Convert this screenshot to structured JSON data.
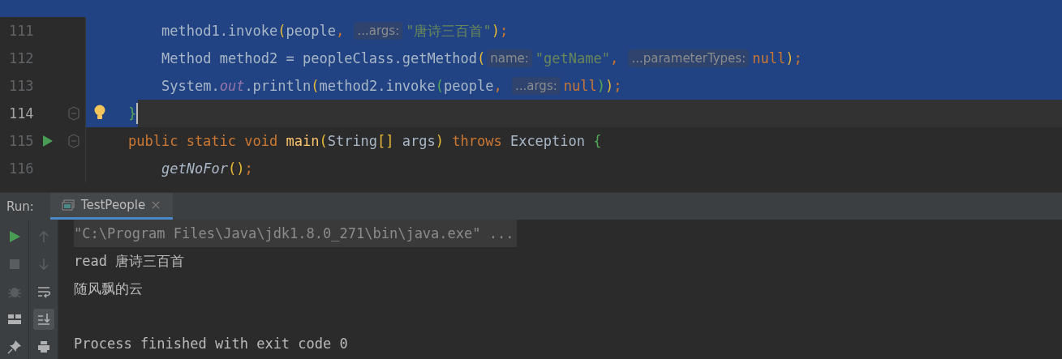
{
  "editor": {
    "lines": [
      {
        "number": "111",
        "selected": true,
        "current": false,
        "run": false,
        "fold": false,
        "bulb": false,
        "tokens": [
          {
            "kind": "text",
            "text": "        method1.invoke"
          },
          {
            "kind": "bracket1",
            "text": "("
          },
          {
            "kind": "text",
            "text": "people"
          },
          {
            "kind": "punct",
            "text": ", "
          },
          {
            "kind": "hint",
            "text": "...args:"
          },
          {
            "kind": "string",
            "text": "\"唐诗三百首\""
          },
          {
            "kind": "bracket1",
            "text": ")"
          },
          {
            "kind": "punct",
            "text": ";"
          }
        ]
      },
      {
        "number": "112",
        "selected": true,
        "current": false,
        "run": false,
        "fold": false,
        "bulb": false,
        "tokens": [
          {
            "kind": "text",
            "text": "        Method method2 = peopleClass.getMethod"
          },
          {
            "kind": "bracket1",
            "text": "("
          },
          {
            "kind": "hint",
            "text": "name:"
          },
          {
            "kind": "string",
            "text": "\"getName\""
          },
          {
            "kind": "punct",
            "text": ", "
          },
          {
            "kind": "hint",
            "text": "...parameterTypes:"
          },
          {
            "kind": "keyword",
            "text": "null"
          },
          {
            "kind": "bracket1",
            "text": ")"
          },
          {
            "kind": "punct",
            "text": ";"
          }
        ]
      },
      {
        "number": "113",
        "selected": true,
        "current": false,
        "run": false,
        "fold": false,
        "bulb": false,
        "tokens": [
          {
            "kind": "text",
            "text": "        System."
          },
          {
            "kind": "static-field",
            "text": "out"
          },
          {
            "kind": "text",
            "text": ".println"
          },
          {
            "kind": "bracket1",
            "text": "("
          },
          {
            "kind": "text",
            "text": "method2.invoke"
          },
          {
            "kind": "bracket2",
            "text": "("
          },
          {
            "kind": "text",
            "text": "people"
          },
          {
            "kind": "punct",
            "text": ", "
          },
          {
            "kind": "hint",
            "text": "...args:"
          },
          {
            "kind": "keyword",
            "text": "null"
          },
          {
            "kind": "bracket2",
            "text": ")"
          },
          {
            "kind": "bracket1",
            "text": ")"
          },
          {
            "kind": "punct",
            "text": ";"
          }
        ]
      },
      {
        "number": "114",
        "selected": true,
        "current": true,
        "run": false,
        "fold": true,
        "bulb": true,
        "tokens": [
          {
            "kind": "bracket2",
            "text": "    }"
          }
        ]
      },
      {
        "number": "115",
        "selected": false,
        "current": false,
        "run": true,
        "fold": true,
        "bulb": false,
        "tokens": [
          {
            "kind": "keyword",
            "text": "    public static void"
          },
          {
            "kind": "decl",
            "text": " main"
          },
          {
            "kind": "bracket1",
            "text": "("
          },
          {
            "kind": "text",
            "text": "String"
          },
          {
            "kind": "bracket1",
            "text": "[]"
          },
          {
            "kind": "text",
            "text": " args"
          },
          {
            "kind": "bracket1",
            "text": ")"
          },
          {
            "kind": "keyword",
            "text": " throws"
          },
          {
            "kind": "text",
            "text": " Exception"
          },
          {
            "kind": "bracket2",
            "text": " {"
          }
        ]
      },
      {
        "number": "116",
        "selected": false,
        "current": false,
        "run": false,
        "fold": false,
        "bulb": false,
        "tokens": [
          {
            "kind": "static-call",
            "text": "        getNoFor"
          },
          {
            "kind": "bracket1",
            "text": "()"
          },
          {
            "kind": "punct",
            "text": ";"
          }
        ]
      }
    ]
  },
  "run_panel": {
    "label": "Run:",
    "tabs": [
      {
        "label": "TestPeople",
        "selected": true,
        "closable": true
      }
    ],
    "tools_left": [
      {
        "kind": "run",
        "disabled": false
      },
      {
        "kind": "stop",
        "disabled": true
      },
      {
        "kind": "debug",
        "disabled": true
      },
      {
        "kind": "layout",
        "disabled": false
      },
      {
        "kind": "pin",
        "disabled": false
      }
    ],
    "tools_right": [
      {
        "kind": "up",
        "disabled": true,
        "selected": false
      },
      {
        "kind": "down",
        "disabled": true,
        "selected": false
      },
      {
        "kind": "wrap",
        "disabled": false,
        "selected": false
      },
      {
        "kind": "scroll-end",
        "disabled": false,
        "selected": true
      },
      {
        "kind": "print",
        "disabled": false,
        "selected": false
      }
    ],
    "console_blocks": [
      {
        "lines": [
          {
            "text": "\"C:\\Program Files\\Java\\jdk1.8.0_271\\bin\\java.exe\" ...",
            "kind": "command"
          },
          {
            "text": "read 唐诗三百首",
            "kind": "output"
          },
          {
            "text": "随风飘的云",
            "kind": "output"
          }
        ]
      },
      {
        "lines": [
          {
            "text": "Process finished with exit code 0",
            "kind": "output"
          }
        ]
      }
    ]
  }
}
